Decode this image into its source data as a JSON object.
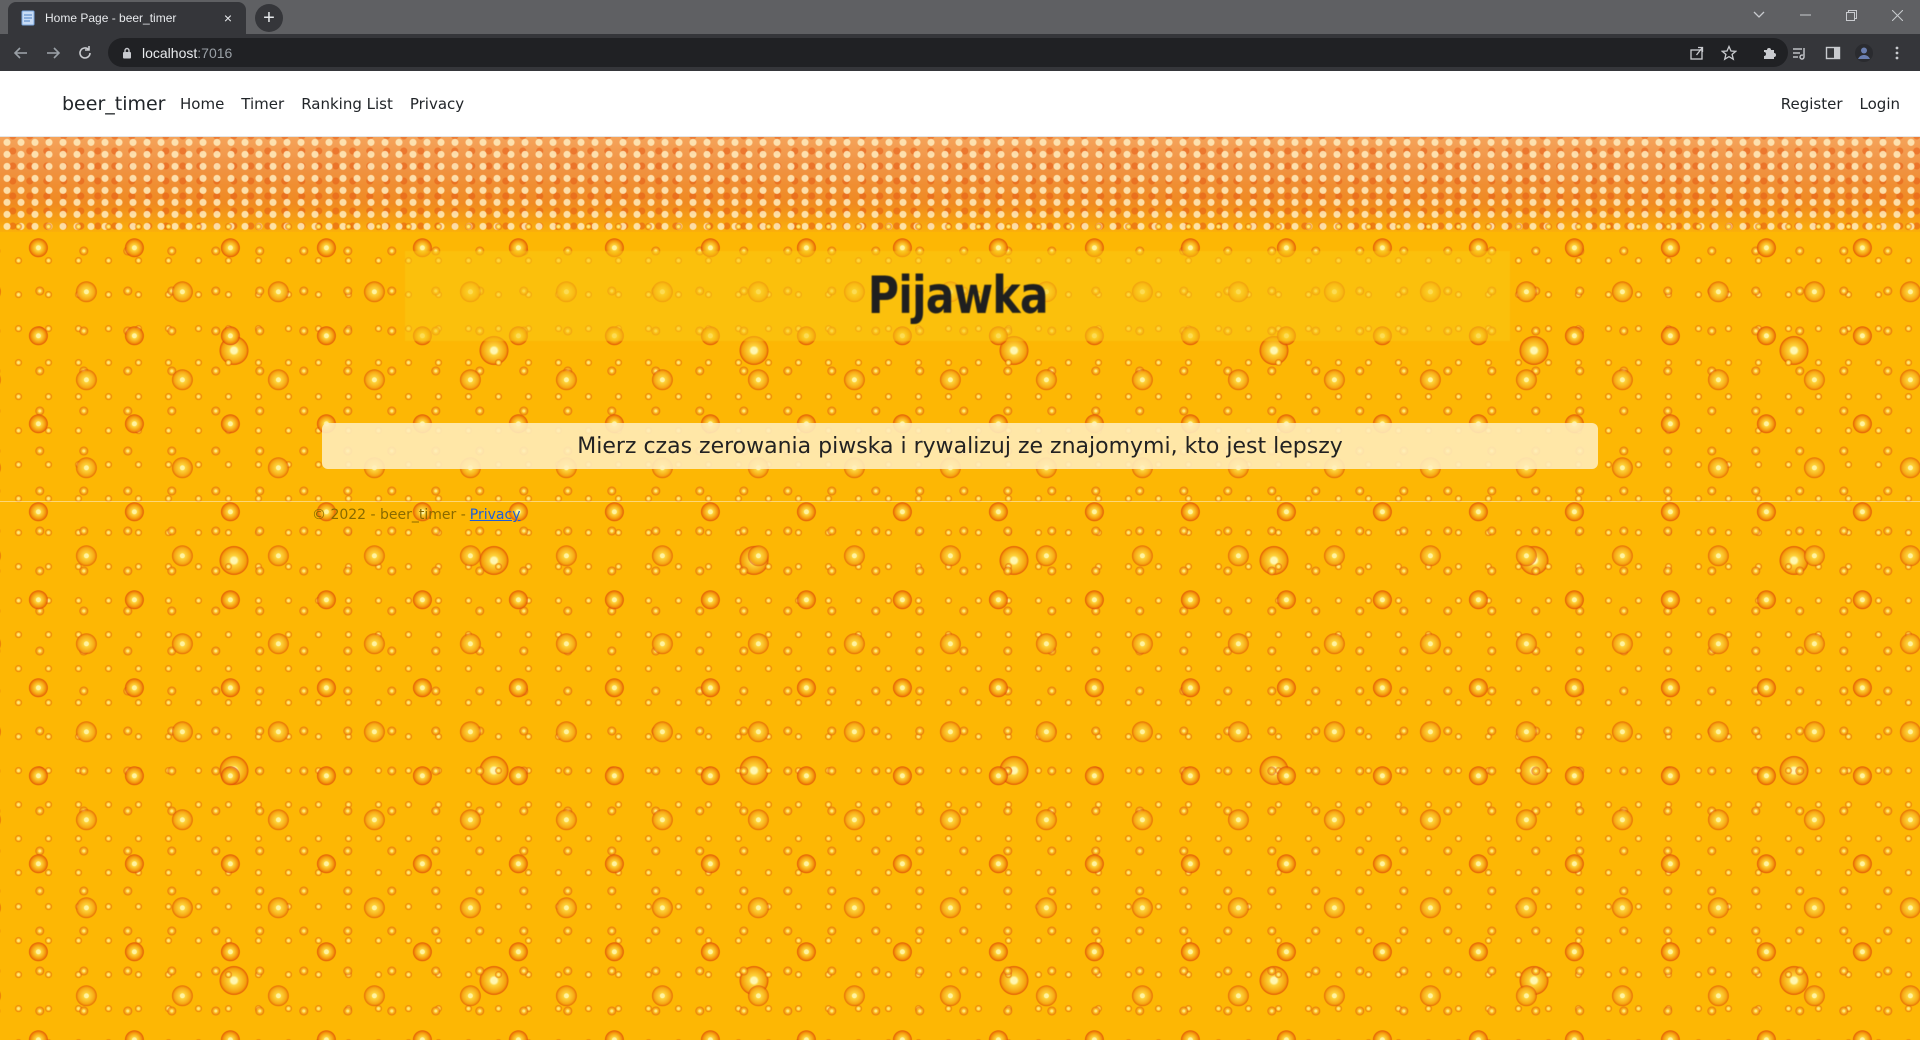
{
  "browser": {
    "tab_title": "Home Page - beer_timer",
    "tab_close": "×",
    "new_tab": "+",
    "address_host": "localhost",
    "address_port": ":7016"
  },
  "site": {
    "brand": "beer_timer",
    "nav_links": [
      "Home",
      "Timer",
      "Ranking List",
      "Privacy"
    ],
    "nav_right": [
      "Register",
      "Login"
    ]
  },
  "hero": {
    "title": "Pijawka",
    "tagline": "Mierz czas zerowania piwska i rywalizuj ze znajomymi, kto jest lepszy"
  },
  "footer": {
    "copyright": "© 2022 - beer_timer -",
    "privacy_link": "Privacy"
  },
  "colors": {
    "beer": "#fdb704",
    "chrome_dark": "#35363a",
    "link": "#1f5ed8"
  }
}
